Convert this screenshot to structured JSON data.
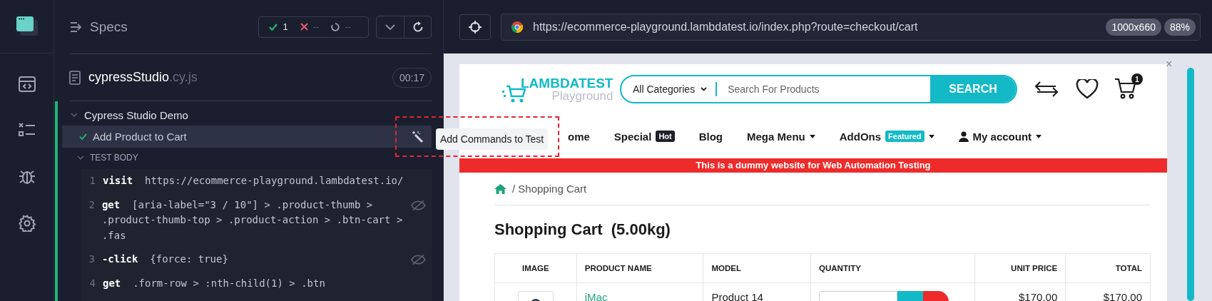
{
  "runner": {
    "title": "Specs",
    "passed": "1",
    "failed": "--",
    "pending": "--"
  },
  "spec": {
    "name": "cypressStudio",
    "extension": ".cy.js",
    "duration": "00:17"
  },
  "suite": {
    "title": "Cypress Studio Demo",
    "expanded": true,
    "test": {
      "title": "Add Product to Cart",
      "selected": true,
      "hook": "TEST BODY",
      "hook_expanded": true,
      "commands": [
        {
          "number": "1",
          "name": "visit",
          "message": "https://ecommerce-playground.lambdatest.io/",
          "hidden": false
        },
        {
          "number": "2",
          "name": "get",
          "message": "[aria-label=\"3 / 10\"] > .product-thumb > .product-thumb-top > .product-action > .btn-cart > .fas",
          "hidden": true
        },
        {
          "number": "3",
          "name": "-click",
          "message": "{force: true}",
          "hidden": true
        },
        {
          "number": "4",
          "name": "get",
          "message": ".form-row > :nth-child(1) > .btn",
          "hidden": false
        }
      ]
    }
  },
  "tooltip": "Add Commands to Test",
  "browser": {
    "url": "https://ecommerce-playground.lambdatest.io/index.php?route=checkout/cart",
    "viewport": "1000x660",
    "zoom": "88%"
  },
  "site": {
    "logo_title": "LAMBDATEST",
    "logo_subtitle": "Playground",
    "category": "All Categories",
    "search_placeholder": "Search For Products",
    "search_button": "SEARCH",
    "cart_count": "1",
    "nav": [
      {
        "label": "ome",
        "dropdown": false
      },
      {
        "label": "Special",
        "badge": {
          "text": "Hot",
          "color": "#1f2029"
        },
        "dropdown": false
      },
      {
        "label": "Blog",
        "dropdown": false
      },
      {
        "label": "Mega Menu",
        "dropdown": true
      },
      {
        "label": "AddOns",
        "badge": {
          "text": "Featured",
          "color": "#13b9c7"
        },
        "dropdown": true
      },
      {
        "label": "My account",
        "user_icon": true,
        "dropdown": true
      }
    ],
    "banner": "This is a dummy website for Web Automation Testing",
    "breadcrumb": "/ Shopping Cart",
    "close": "×",
    "heading": "Shopping Cart  (5.00kg)",
    "table": {
      "columns": [
        "IMAGE",
        "PRODUCT NAME",
        "MODEL",
        "QUANTITY",
        "UNIT PRICE",
        "TOTAL"
      ],
      "rows": [
        {
          "product": "iMac",
          "model": "Product 14",
          "unit_price": "$170.00",
          "total": "$170.00"
        }
      ]
    }
  }
}
